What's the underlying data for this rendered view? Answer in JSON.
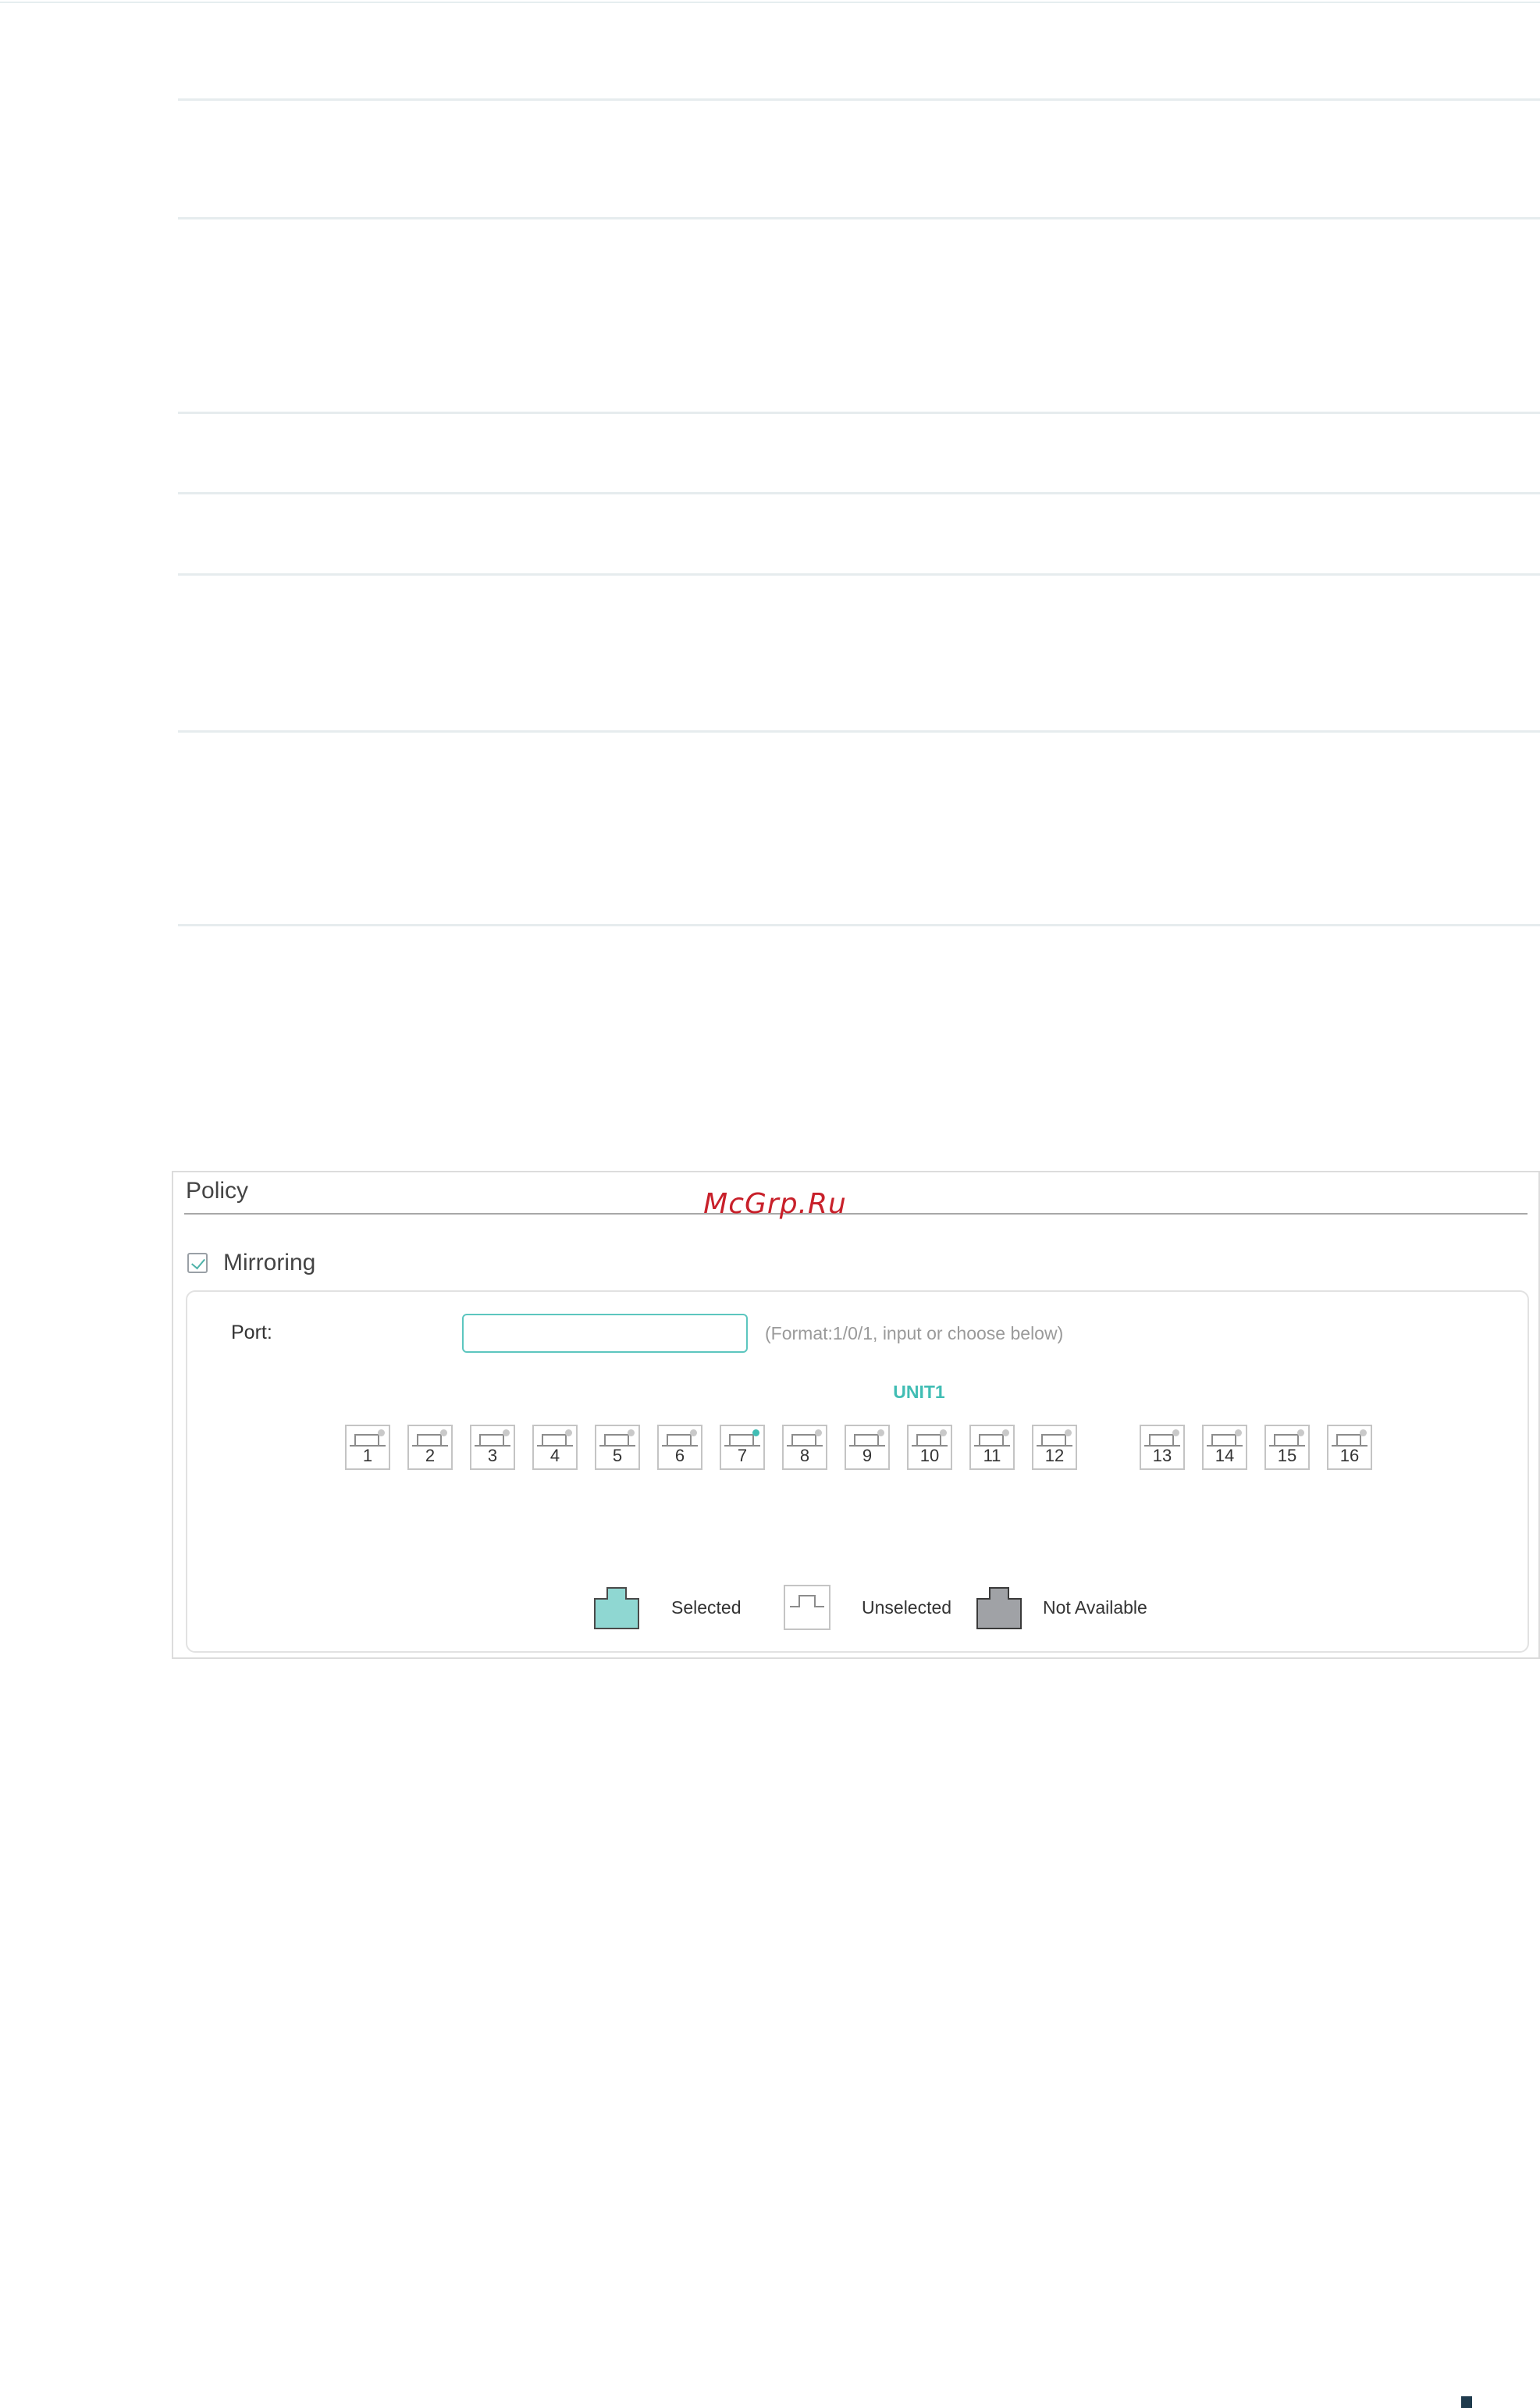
{
  "watermark": "McGrp.Ru",
  "policy": {
    "title": "Policy",
    "mirroring": {
      "label": "Mirroring",
      "checked": true
    },
    "port": {
      "label": "Port:",
      "value": "",
      "hint": "(Format:1/0/1, input or choose below)"
    },
    "unit": "UNIT1",
    "ports": [
      {
        "label": "1",
        "active": false
      },
      {
        "label": "2",
        "active": false
      },
      {
        "label": "3",
        "active": false
      },
      {
        "label": "4",
        "active": false
      },
      {
        "label": "5",
        "active": false
      },
      {
        "label": "6",
        "active": false
      },
      {
        "label": "7",
        "active": true
      },
      {
        "label": "8",
        "active": false
      },
      {
        "label": "9",
        "active": false
      },
      {
        "label": "10",
        "active": false
      },
      {
        "label": "11",
        "active": false
      },
      {
        "label": "12",
        "active": false
      },
      {
        "label": "13",
        "active": false
      },
      {
        "label": "14",
        "active": false
      },
      {
        "label": "15",
        "active": false
      },
      {
        "label": "16",
        "active": false
      }
    ],
    "legend": {
      "selected": "Selected",
      "unselected": "Unselected",
      "not_available": "Not Available"
    }
  },
  "colors": {
    "accent": "#41bdb4",
    "selected_fill": "#8fd7d2",
    "not_available_fill": "#a0a2a6"
  }
}
